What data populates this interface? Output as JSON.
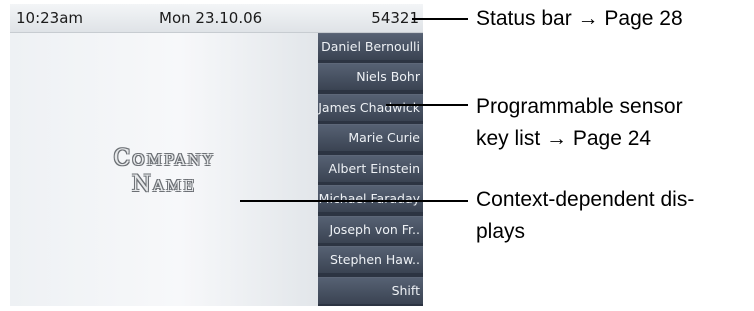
{
  "status_bar": {
    "time": "10:23am",
    "date": "Mon 23.10.06",
    "number": "54321"
  },
  "logo": {
    "line1": "Company",
    "line2": "Name"
  },
  "keys": [
    "Daniel Bernoulli",
    "Niels Bohr",
    "James Chadwick",
    "Marie Curie",
    "Albert Einstein",
    "Michael Faraday",
    "Joseph von Fr..",
    "Stephen Haw..",
    "Shift"
  ],
  "callouts": {
    "status": {
      "line1": "Status bar → Page 28"
    },
    "keys": {
      "line1": "Programmable sensor",
      "line2": "key list → Page 24"
    },
    "context": {
      "line1": "Context-dependent dis-",
      "line2": "plays"
    }
  }
}
